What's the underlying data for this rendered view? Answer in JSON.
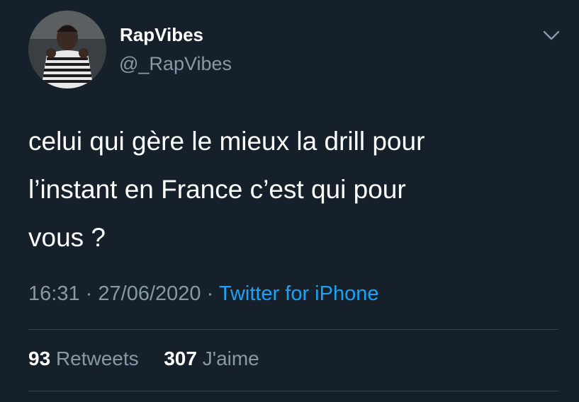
{
  "tweet": {
    "display_name": "RapVibes",
    "handle": "@_RapVibes",
    "text_lines": [
      "celui qui gère le mieux la drill pour",
      "l’instant en France c’est qui pour",
      "vous ?"
    ],
    "time": "16:31",
    "separator": "·",
    "date": "27/06/2020",
    "source": "Twitter for iPhone",
    "retweet_count": "93",
    "retweet_label": "Retweets",
    "like_count": "307",
    "like_label": "J'aime"
  },
  "icons": {
    "menu": "chevron-down-icon",
    "avatar": "profile-photo"
  },
  "colors": {
    "background": "#15202b",
    "primary_text": "#ffffff",
    "secondary_text": "#8899a6",
    "accent": "#1da1f2",
    "divider": "#38444d"
  }
}
